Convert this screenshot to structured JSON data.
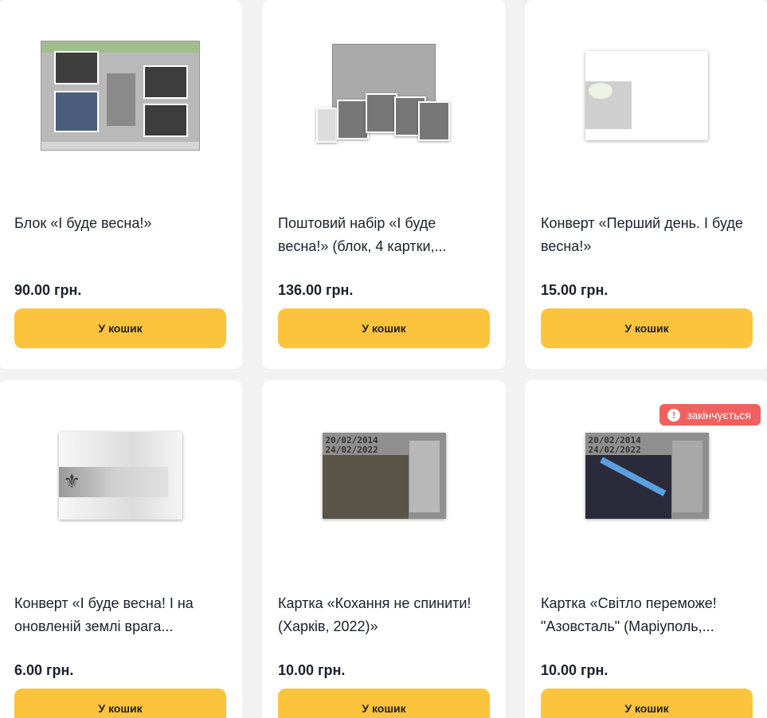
{
  "products": [
    {
      "title": "Блок «І буде весна!»",
      "price": "90.00 грн.",
      "button": "У кошик",
      "image": "stamp-block"
    },
    {
      "title": "Поштовий набір «І буде весна!» (блок, 4 картки,...",
      "price": "136.00 грн.",
      "button": "У кошик",
      "image": "postal-set"
    },
    {
      "title": "Конверт «Перший день. І буде весна!»",
      "price": "15.00 грн.",
      "button": "У кошик",
      "image": "first-day-envelope"
    },
    {
      "title": "Конверт «І буде весна! І на оновленій землі врага...",
      "price": "6.00 грн.",
      "button": "У кошик",
      "image": "envelope"
    },
    {
      "title": "Картка «Кохання не спинити! (Харків, 2022)»",
      "price": "10.00 грн.",
      "button": "У кошик",
      "image": "postcard-kharkiv",
      "dates": "20/02/2014\n24/02/2022"
    },
    {
      "title": "Картка «Світло переможе! \"Азовсталь\" (Маріуполь,...",
      "price": "10.00 грн.",
      "button": "У кошик",
      "image": "postcard-azovstal",
      "dates": "20/02/2014\n24/02/2022",
      "badge": "закінчується"
    }
  ],
  "colors": {
    "button": "#fcc33c",
    "badge": "#f0605f",
    "text": "#1b1f2e",
    "background": "#f2f2f2"
  }
}
